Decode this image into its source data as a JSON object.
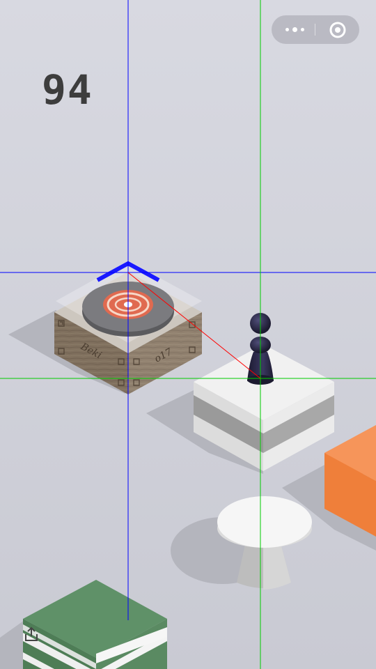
{
  "hud": {
    "score": "94"
  },
  "miniprogram_capsule": {
    "more_icon": "more-dots-icon",
    "close_icon": "target-close-icon"
  },
  "platforms": [
    {
      "name": "music-box-platform",
      "text_left": "Beki",
      "text_right": "o17"
    },
    {
      "name": "white-striped-cube-platform"
    },
    {
      "name": "orange-cube-platform",
      "color": "#f08040"
    },
    {
      "name": "round-table-platform"
    },
    {
      "name": "green-striped-cube-platform",
      "color": "#5f9168"
    }
  ],
  "player": {
    "name": "chess-pawn-player",
    "color": "#2a2840"
  },
  "debug_lines": {
    "blue": "#0000ff",
    "green": "#00cc00",
    "red": "#ff0000"
  },
  "share_icon": "share-icon"
}
